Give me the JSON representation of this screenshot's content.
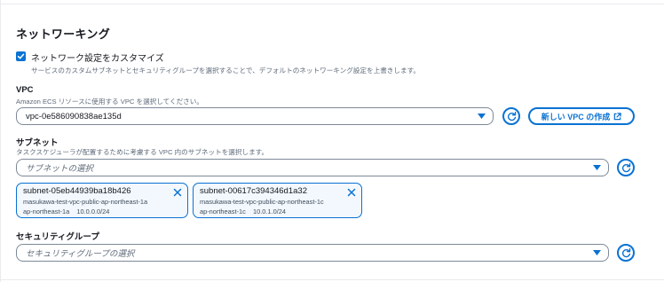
{
  "section": {
    "title": "ネットワーキング"
  },
  "customize": {
    "checked": true,
    "label": "ネットワーク設定をカスタマイズ",
    "description": "サービスのカスタムサブネットとセキュリティグループを選択することで、デフォルトのネットワーキング設定を上書きします。"
  },
  "vpc": {
    "label": "VPC",
    "description": "Amazon ECS リソースに使用する VPC を選択してください。",
    "value": "vpc-0e586090838ae135d",
    "create_button": "新しい VPC の作成"
  },
  "subnet": {
    "label": "サブネット",
    "description": "タスクスケジューラが配置するために考慮する VPC 内のサブネットを選択します。",
    "placeholder": "サブネットの選択",
    "tokens": [
      {
        "id": "subnet-05eb44939ba18b426",
        "name": "masukawa-test-vpc-public-ap-northeast-1a",
        "az": "ap-northeast-1a",
        "cidr": "10.0.0.0/24"
      },
      {
        "id": "subnet-00617c394346d1a32",
        "name": "masukawa-test-vpc-public-ap-northeast-1c",
        "az": "ap-northeast-1c",
        "cidr": "10.0.1.0/24"
      }
    ]
  },
  "security_group": {
    "label": "セキュリティグループ",
    "placeholder": "セキュリティグループの選択"
  },
  "colors": {
    "accent": "#0972d3",
    "border": "#7d8998",
    "muted": "#5f6b7a",
    "token_bg": "#f2f8fd"
  }
}
